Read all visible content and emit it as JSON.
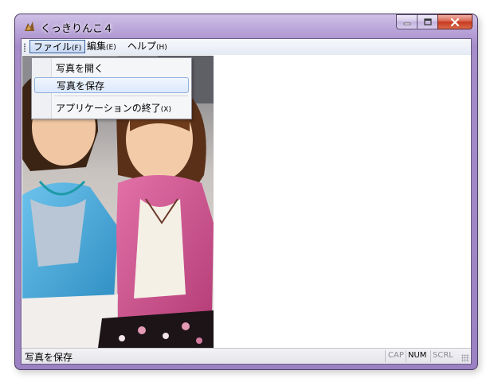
{
  "window": {
    "title": "くっきりんこ４",
    "icon": "app-icon"
  },
  "menubar": {
    "items": [
      {
        "label": "ファイル",
        "accel": "(F)"
      },
      {
        "label": "編集",
        "accel": "(E)"
      },
      {
        "label": "ヘルプ",
        "accel": "(H)"
      }
    ]
  },
  "file_menu": {
    "items": [
      {
        "label": "写真を開く",
        "accel": ""
      },
      {
        "label": "写真を保存",
        "accel": ""
      },
      {
        "label": "アプリケーションの終了",
        "accel": "(X)"
      }
    ],
    "highlighted": "写真を保存"
  },
  "statusbar": {
    "text": "写真を保存",
    "indicators": {
      "cap": "CAP",
      "num": "NUM",
      "scrl": "SCRL"
    }
  },
  "colors": {
    "frame": "#a68cc9",
    "close_button": "#c7391e",
    "menu_highlight": "#dbe8fb",
    "cardigan_blue": "#4aa8d8",
    "cardigan_pink": "#c9508a"
  }
}
